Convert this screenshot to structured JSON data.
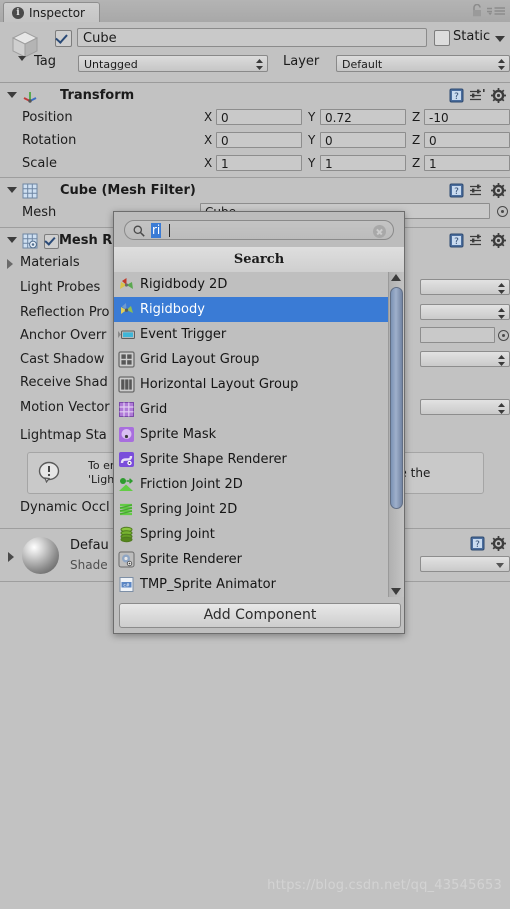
{
  "window": {
    "tab_label": "Inspector",
    "tab_icon": "info-icon",
    "lock_icon": "lock-icon",
    "menu_icon": "hamburger-menu-icon"
  },
  "object_header": {
    "icon": "cube-prefab-icon",
    "active_checked": true,
    "name_value": "Cube",
    "static_label": "Static",
    "static_checked": false,
    "tag_label": "Tag",
    "tag_value": "Untagged",
    "layer_label": "Layer",
    "layer_value": "Default"
  },
  "transform": {
    "title": "Transform",
    "icon": "transform-axis-icon",
    "rows": [
      {
        "label": "Position",
        "x": "0",
        "y": "0.72",
        "z": "-10"
      },
      {
        "label": "Rotation",
        "x": "0",
        "y": "0",
        "z": "0"
      },
      {
        "label": "Scale",
        "x": "1",
        "y": "1",
        "z": "1"
      }
    ],
    "axis_labels": {
      "x": "X",
      "y": "Y",
      "z": "Z"
    }
  },
  "mesh_filter": {
    "title": "Cube (Mesh Filter)",
    "icon": "mesh-filter-icon",
    "mesh_label": "Mesh",
    "mesh_value": "Cube"
  },
  "mesh_renderer": {
    "title": "Mesh R",
    "icon": "mesh-renderer-icon",
    "enabled_checked": true,
    "rows": [
      {
        "label": "Materials"
      },
      {
        "label": "Light Probes"
      },
      {
        "label": "Reflection Pro"
      },
      {
        "label": "Anchor Overr"
      },
      {
        "label": "Cast Shadow"
      },
      {
        "label": "Receive Shad"
      },
      {
        "label": "Motion Vector"
      },
      {
        "label": "Lightmap Sta"
      },
      {
        "label": "Dynamic Occl"
      }
    ],
    "warning": {
      "icon": "warning-info-icon",
      "line1": "To enabl",
      "line2": "'Lightmap",
      "tail": "please enable the"
    }
  },
  "material_preview": {
    "name": "Defau",
    "shader_label": "Shade",
    "sphere_icon": "material-sphere-preview"
  },
  "add_component_popup": {
    "search_placeholder": "",
    "search_value": "ri",
    "search_icon": "search-icon",
    "clear_icon": "clear-circle-icon",
    "header_label": "Search",
    "add_component_label": "Add Component",
    "scroll_up_icon": "scroll-up-arrow-icon",
    "scroll_down_icon": "scroll-down-arrow-icon",
    "items": [
      {
        "label": "Rigidbody 2D",
        "icon": "rigidbody-2d-icon",
        "selected": false
      },
      {
        "label": "Rigidbody",
        "icon": "rigidbody-icon",
        "selected": true
      },
      {
        "label": "Event Trigger",
        "icon": "event-trigger-icon",
        "selected": false
      },
      {
        "label": "Grid Layout Group",
        "icon": "grid-layout-group-icon",
        "selected": false
      },
      {
        "label": "Horizontal Layout Group",
        "icon": "horizontal-layout-group-icon",
        "selected": false
      },
      {
        "label": "Grid",
        "icon": "grid-icon",
        "selected": false
      },
      {
        "label": "Sprite Mask",
        "icon": "sprite-mask-icon",
        "selected": false
      },
      {
        "label": "Sprite Shape Renderer",
        "icon": "sprite-shape-renderer-icon",
        "selected": false
      },
      {
        "label": "Friction Joint 2D",
        "icon": "friction-joint-2d-icon",
        "selected": false
      },
      {
        "label": "Spring Joint 2D",
        "icon": "spring-joint-2d-icon",
        "selected": false
      },
      {
        "label": "Spring Joint",
        "icon": "spring-joint-icon",
        "selected": false
      },
      {
        "label": "Sprite Renderer",
        "icon": "sprite-renderer-icon",
        "selected": false
      },
      {
        "label": "TMP_Sprite Animator",
        "icon": "tmp-sprite-animator-icon",
        "selected": false
      }
    ]
  },
  "component_header_icons": {
    "help": "help-book-icon",
    "preset": "preset-sliders-icon",
    "settings": "gear-icon"
  },
  "watermark": "https://blog.csdn.net/qq_43545653",
  "colors": {
    "background": "#c2c2c2",
    "selection": "#3a7bd5",
    "field": "#c9c9c9"
  }
}
